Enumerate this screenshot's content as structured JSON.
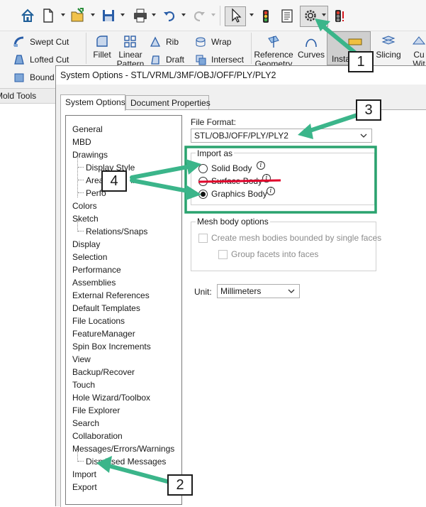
{
  "ribbon": {
    "swept_cut": "Swept Cut",
    "lofted_cut": "Lofted Cut",
    "boundary_cut": "Bound",
    "fillet": "Fillet",
    "linear_pattern_1": "Linear",
    "linear_pattern_2": "Pattern",
    "rib": "Rib",
    "draft": "Draft",
    "wrap": "Wrap",
    "intersect": "Intersect",
    "reference_geometry_1": "Reference",
    "reference_geometry_2": "Geometry",
    "curves": "Curves",
    "instant3d": "Insta",
    "slicing": "Slicing",
    "cut_with_1": "Cu",
    "cut_with_2": "Wit",
    "tab_mold_tools": "Mold Tools"
  },
  "dialog": {
    "title": "System Options - STL/VRML/3MF/OBJ/OFF/PLY/PLY2",
    "tabs": [
      "System Options",
      "Document Properties"
    ]
  },
  "tree": {
    "items": [
      {
        "label": "General",
        "level": 0
      },
      {
        "label": "MBD",
        "level": 0
      },
      {
        "label": "Drawings",
        "level": 0
      },
      {
        "label": "Display Style",
        "level": 1
      },
      {
        "label": "Area",
        "level": 1
      },
      {
        "label": "Perfo",
        "level": 1
      },
      {
        "label": "Colors",
        "level": 0
      },
      {
        "label": "Sketch",
        "level": 0
      },
      {
        "label": "Relations/Snaps",
        "level": 1
      },
      {
        "label": "Display",
        "level": 0
      },
      {
        "label": "Selection",
        "level": 0
      },
      {
        "label": "Performance",
        "level": 0
      },
      {
        "label": "Assemblies",
        "level": 0
      },
      {
        "label": "External References",
        "level": 0
      },
      {
        "label": "Default Templates",
        "level": 0
      },
      {
        "label": "File Locations",
        "level": 0
      },
      {
        "label": "FeatureManager",
        "level": 0
      },
      {
        "label": "Spin Box Increments",
        "level": 0
      },
      {
        "label": "View",
        "level": 0
      },
      {
        "label": "Backup/Recover",
        "level": 0
      },
      {
        "label": "Touch",
        "level": 0
      },
      {
        "label": "Hole Wizard/Toolbox",
        "level": 0
      },
      {
        "label": "File Explorer",
        "level": 0
      },
      {
        "label": "Search",
        "level": 0
      },
      {
        "label": "Collaboration",
        "level": 0
      },
      {
        "label": "Messages/Errors/Warnings",
        "level": 0
      },
      {
        "label": "Dismissed Messages",
        "level": 1
      },
      {
        "label": "Import",
        "level": 0
      },
      {
        "label": "Export",
        "level": 0
      }
    ],
    "area_suffix": "ill"
  },
  "options": {
    "file_format_label": "File Format:",
    "file_format_value": "STL/OBJ/OFF/PLY/PLY2",
    "import_as_label": "Import as",
    "solid_body": "Solid Body",
    "surface_body": "Surface Body",
    "graphics_body": "Graphics Body",
    "selected_import": "Graphics Body",
    "mesh_options_label": "Mesh body options",
    "create_mesh_bodies": "Create mesh bodies bounded by single faces",
    "group_facets": "Group facets into faces",
    "unit_label": "Unit:",
    "unit_value": "Millimeters"
  },
  "callouts": [
    "1",
    "2",
    "3",
    "4"
  ],
  "colors": {
    "callout_arrow": "#3bb58a",
    "callout_box": "#2aa36f",
    "strike": "#e0002a",
    "highlight_border": "#2aa36f"
  }
}
